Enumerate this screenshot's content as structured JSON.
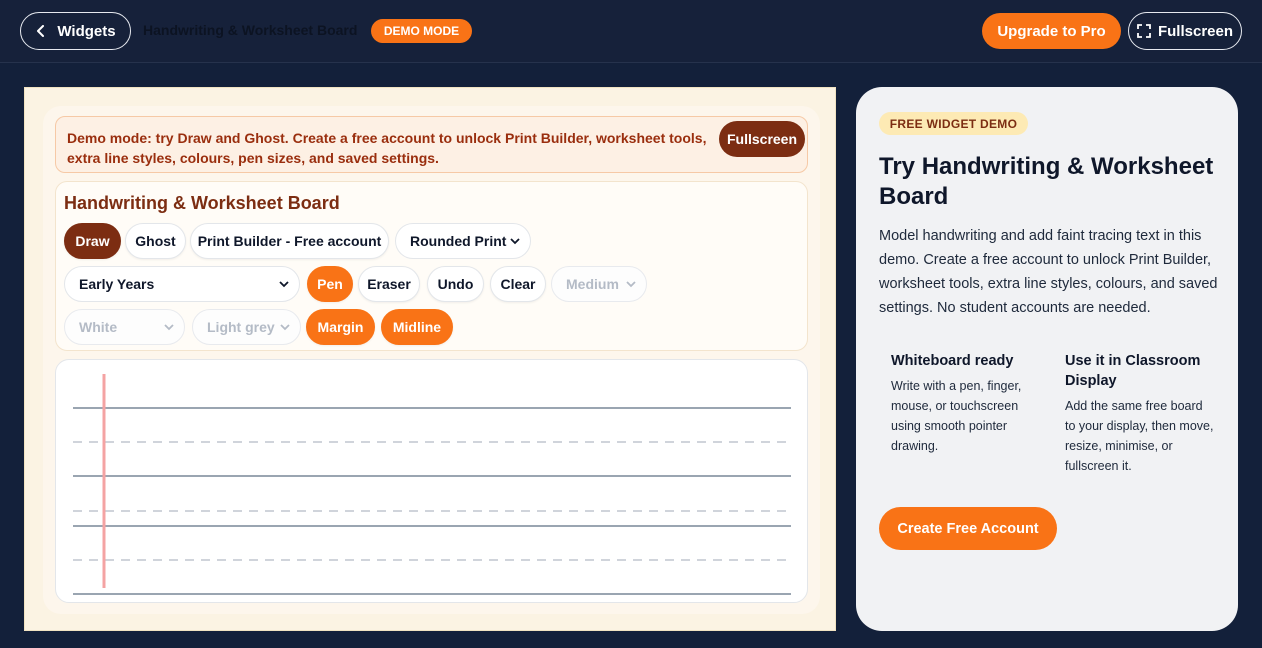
{
  "topbar": {
    "back_label": "Widgets",
    "title": "Handwriting & Worksheet Board",
    "demo_badge": "DEMO MODE",
    "upgrade_label": "Upgrade to Pro",
    "fullscreen_label": "Fullscreen"
  },
  "notice": {
    "text": "Demo mode: try Draw and Ghost. Create a free account to unlock Print Builder, worksheet tools, extra line styles, colours, pen sizes, and saved settings.",
    "fullscreen_label": "Fullscreen"
  },
  "board": {
    "title": "Handwriting & Worksheet Board",
    "modes": [
      "Draw",
      "Ghost",
      "Print Builder - Free account"
    ],
    "font_select": "Rounded Print",
    "level_select": "Early Years",
    "tools": [
      "Pen",
      "Eraser",
      "Undo",
      "Clear"
    ],
    "size_select": "Medium",
    "background_select": "White",
    "line_colour_select": "Light grey",
    "toggles": [
      "Margin",
      "Midline"
    ]
  },
  "side": {
    "badge": "FREE WIDGET DEMO",
    "title": "Try Handwriting & Worksheet Board",
    "description": "Model handwriting and add faint tracing text in this demo. Create a free account to unlock Print Builder, worksheet tools, extra line styles, colours, and saved settings. No student accounts are needed.",
    "features": [
      {
        "title": "Whiteboard ready",
        "text": "Write with a pen, finger, mouse, or touchscreen using smooth pointer drawing."
      },
      {
        "title": "Use it in Classroom Display",
        "text": "Add the same free board to your display, then move, resize, minimise, or fullscreen it."
      }
    ],
    "cta_label": "Create Free Account"
  },
  "colors": {
    "accent": "#f97316",
    "dark_brown": "#7c2d12",
    "navy": "#13203a",
    "margin_line": "#f4a3a3",
    "guide_line": "#9aa5b1"
  }
}
